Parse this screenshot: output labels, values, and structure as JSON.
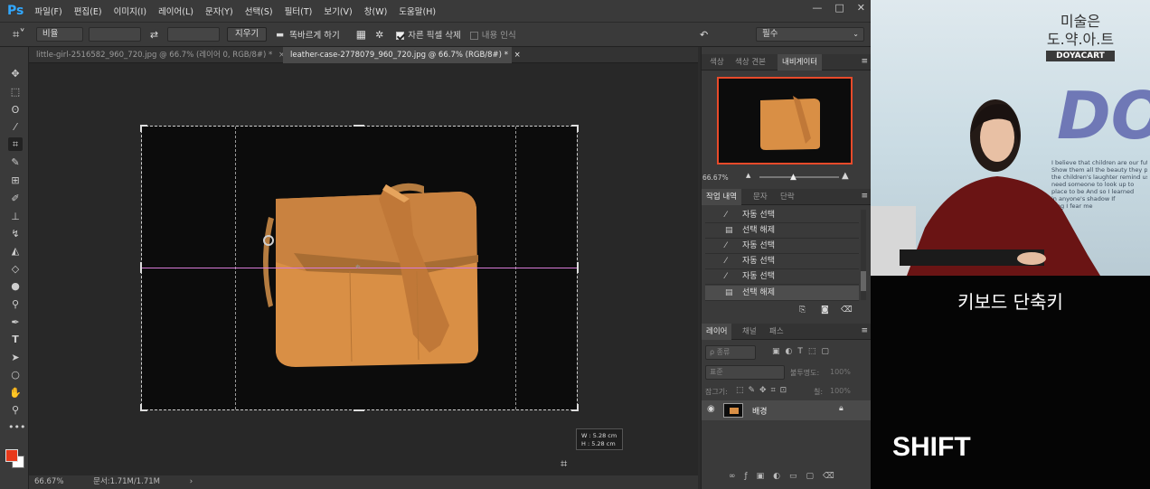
{
  "app": {
    "logo": "Ps"
  },
  "menu": [
    "파일(F)",
    "편집(E)",
    "이미지(I)",
    "레이어(L)",
    "문자(Y)",
    "선택(S)",
    "필터(T)",
    "보기(V)",
    "창(W)",
    "도움말(H)"
  ],
  "window_controls": [
    "—",
    "□",
    "✕"
  ],
  "options": {
    "ratio_label": "비율",
    "clear_label": "지우기",
    "straighten_label": "똑바르게 하기",
    "delete_cropped_label": "자른 픽셀 삭제",
    "delete_cropped_checked": true,
    "content_aware_label": "내용 인식",
    "content_aware_checked": false,
    "workspace": "필수"
  },
  "tabs": [
    {
      "label": "little-girl-2516582_960_720.jpg @ 66.7% (레이어 0, RGB/8#) *",
      "close": "×"
    },
    {
      "label": "leather-case-2778079_960_720.jpg @ 66.7% (RGB/8#) *",
      "close": "×"
    }
  ],
  "canvas": {
    "dims_tooltip": {
      "w": "W :  5.28 cm",
      "h": "H :  5.28 cm"
    }
  },
  "status": {
    "zoom": "66.67%",
    "doc": "문서:1.71M/1.71M",
    "arrow": "›"
  },
  "navigator": {
    "tabs": [
      "색상",
      "색상 견본",
      "내비게이터"
    ],
    "zoom": "66.67%"
  },
  "history": {
    "tabs": [
      "작업 내역",
      "문자",
      "단락"
    ],
    "items": [
      {
        "label": "자동 선택",
        "icon": "magic-wand"
      },
      {
        "label": "선택 해제",
        "icon": "document"
      },
      {
        "label": "자동 선택",
        "icon": "magic-wand"
      },
      {
        "label": "자동 선택",
        "icon": "magic-wand"
      },
      {
        "label": "자동 선택",
        "icon": "magic-wand"
      },
      {
        "label": "선택 해제",
        "icon": "document",
        "selected": true
      }
    ]
  },
  "layers": {
    "tabs": [
      "레이어",
      "채널",
      "패스"
    ],
    "kind": "ρ 종류",
    "blend": "표준",
    "opacity_label": "불투명도:",
    "opacity": "100%",
    "lock_label": "잠그기:",
    "fill_label": "칠:",
    "fill": "100%",
    "layer_name": "배경"
  },
  "video": {
    "brand_top": "미술은",
    "brand_mid": "도.약.아.트",
    "brand_bottom": "DOYACART",
    "caption": "키보드 단축키",
    "key": "SHIFT",
    "bg_letters": "DO",
    "bg_text": "I believe that children are our future\nShow them all the beauty they possess\nthe children's laughter remind us\nneed someone to look up to\nplace to be And so I learned\nin anyone's shadow If\nhing I fear me\nme"
  },
  "colors": {
    "accent": "#31a8ff",
    "foreground": "#e8391a",
    "background": "#ffffff",
    "bag": "#d98f45"
  }
}
